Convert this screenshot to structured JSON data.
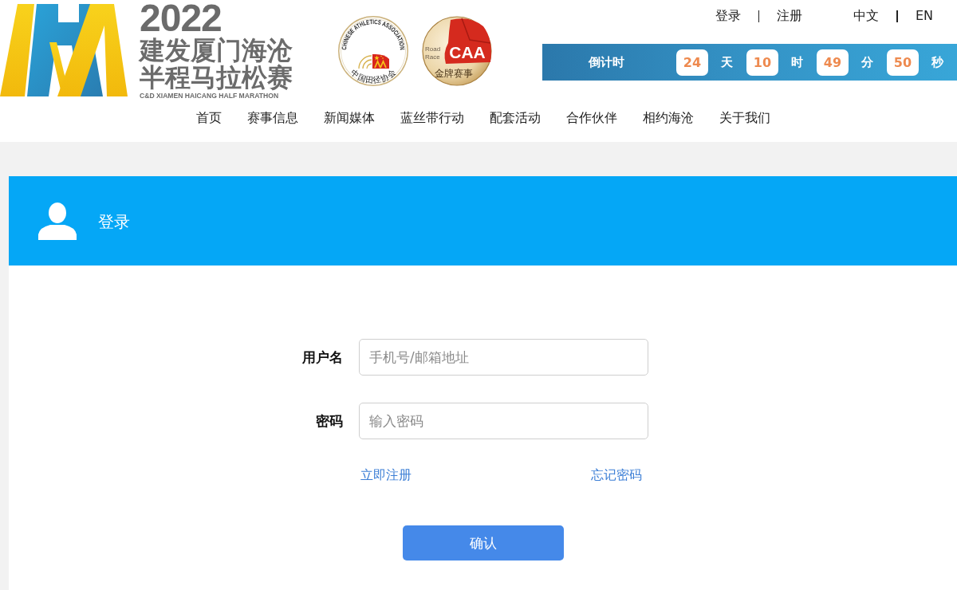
{
  "header": {
    "logo": {
      "year": "2022",
      "title_lines": [
        "建发厦门海沧",
        "半程马拉松赛"
      ],
      "subtitle": "C&D XIAMEN HAICANG HALF MARATHON"
    },
    "badges": [
      {
        "kind": "association",
        "ring_text": "CHINESE ATHLETICS ASSOCIATION",
        "caption": "中国田径协会"
      },
      {
        "kind": "road_race",
        "tag_lines": [
          "Road",
          "Race"
        ],
        "mark": "CAA",
        "caption": "金牌赛事"
      }
    ],
    "account_links": [
      "登录",
      "注册"
    ],
    "language_links": [
      "中文",
      "EN"
    ],
    "countdown": {
      "label": "倒计时",
      "parts": [
        {
          "value": "24",
          "unit": "天"
        },
        {
          "value": "10",
          "unit": "时"
        },
        {
          "value": "49",
          "unit": "分"
        },
        {
          "value": "50",
          "unit": "秒"
        }
      ]
    },
    "nav": [
      "首页",
      "赛事信息",
      "新闻媒体",
      "蓝丝带行动",
      "配套活动",
      "合作伙伴",
      "相约海沧",
      "关于我们"
    ]
  },
  "login_panel": {
    "title": "登录",
    "fields": [
      {
        "label": "用户名",
        "placeholder": "手机号/邮箱地址"
      },
      {
        "label": "密码",
        "placeholder": "输入密码"
      }
    ],
    "links": [
      "立即注册",
      "忘记密码"
    ],
    "submit": "确认"
  }
}
